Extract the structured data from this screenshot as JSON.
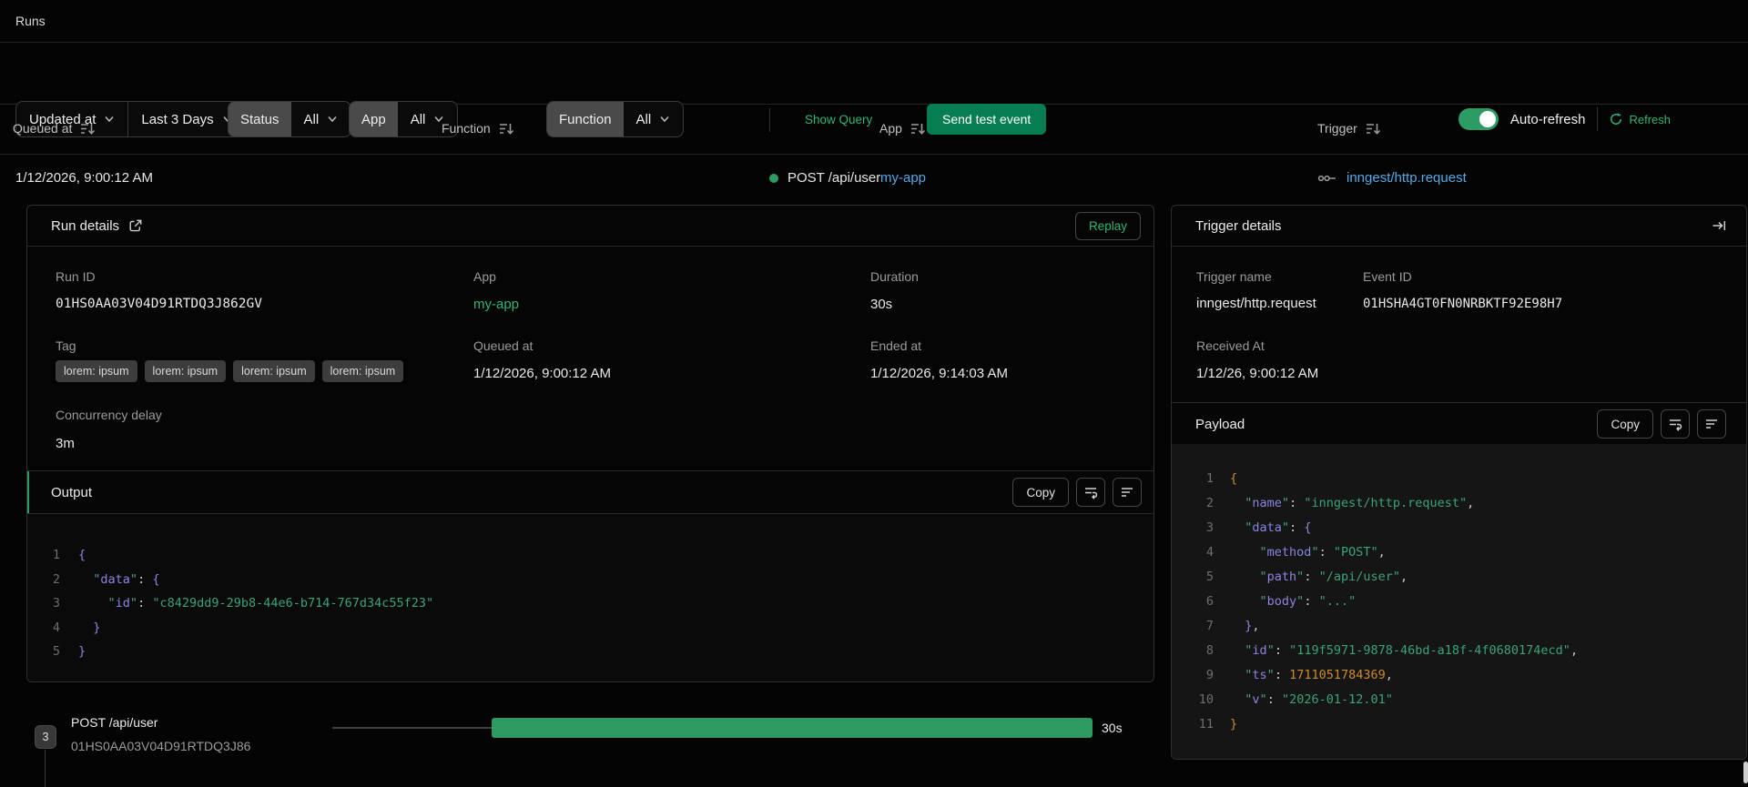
{
  "topbar": {
    "title": "Runs"
  },
  "filters": {
    "sort_field": "Updated at",
    "time_range": "Last 3 Days",
    "status_label": "Status",
    "status_value": "All",
    "app_label": "App",
    "app_value": "All",
    "function_label": "Function",
    "function_value": "All",
    "show_query": "Show Query",
    "send_test_event": "Send test event",
    "auto_refresh_label": "Auto-refresh",
    "auto_refresh_on": true,
    "refresh_label": "Refresh"
  },
  "table": {
    "columns": [
      "Queued at",
      "Function",
      "App",
      "Trigger"
    ],
    "row": {
      "queued_at": "1/12/2026, 9:00:12 AM",
      "function": "POST /api/user",
      "app": "my-app",
      "trigger": "inngest/http.request"
    }
  },
  "run_details": {
    "title": "Run details",
    "replay_label": "Replay",
    "run_id_label": "Run ID",
    "run_id": "01HS0AA03V04D91RTDQ3J862GV",
    "app_label": "App",
    "app": "my-app",
    "duration_label": "Duration",
    "duration": "30s",
    "tag_label": "Tag",
    "tags": [
      "lorem: ipsum",
      "lorem: ipsum",
      "lorem: ipsum",
      "lorem: ipsum"
    ],
    "queued_at_label": "Queued at",
    "queued_at": "1/12/2026, 9:00:12 AM",
    "ended_at_label": "Ended at",
    "ended_at": "1/12/2026, 9:14:03 AM",
    "concurrency_label": "Concurrency delay",
    "concurrency": "3m",
    "output": {
      "title": "Output",
      "copy_label": "Copy",
      "lines": [
        {
          "n": 1,
          "t": [
            [
              "br1",
              "{"
            ]
          ]
        },
        {
          "n": 2,
          "t": [
            [
              "pun",
              "  "
            ],
            [
              "qk",
              "\""
            ],
            [
              "key",
              "data"
            ],
            [
              "qk",
              "\""
            ],
            [
              "pun",
              ": "
            ],
            [
              "br1",
              "{"
            ]
          ]
        },
        {
          "n": 3,
          "t": [
            [
              "pun",
              "    "
            ],
            [
              "qk",
              "\""
            ],
            [
              "key",
              "id"
            ],
            [
              "qk",
              "\""
            ],
            [
              "pun",
              ": "
            ],
            [
              "str",
              "\"c8429dd9-29b8-44e6-b714-767d34c55f23\""
            ]
          ]
        },
        {
          "n": 4,
          "t": [
            [
              "pun",
              "  "
            ],
            [
              "br1",
              "}"
            ]
          ]
        },
        {
          "n": 5,
          "t": [
            [
              "br1",
              "}"
            ]
          ]
        }
      ]
    }
  },
  "trigger_details": {
    "title": "Trigger details",
    "trigger_name_label": "Trigger name",
    "trigger_name": "inngest/http.request",
    "event_id_label": "Event ID",
    "event_id": "01HSHA4GT0FN0NRBKTF92E98H7",
    "received_at_label": "Received At",
    "received_at": "1/12/26, 9:00:12 AM",
    "payload": {
      "title": "Payload",
      "copy_label": "Copy",
      "lines": [
        {
          "n": 1,
          "t": [
            [
              "br0",
              "{"
            ]
          ]
        },
        {
          "n": 2,
          "t": [
            [
              "pun",
              "  "
            ],
            [
              "qk",
              "\""
            ],
            [
              "key",
              "name"
            ],
            [
              "qk",
              "\""
            ],
            [
              "pun",
              ": "
            ],
            [
              "str",
              "\"inngest/http.request\""
            ],
            [
              "pun",
              ","
            ]
          ]
        },
        {
          "n": 3,
          "t": [
            [
              "pun",
              "  "
            ],
            [
              "qk",
              "\""
            ],
            [
              "key",
              "data"
            ],
            [
              "qk",
              "\""
            ],
            [
              "pun",
              ": "
            ],
            [
              "br1",
              "{"
            ]
          ]
        },
        {
          "n": 4,
          "t": [
            [
              "pun",
              "    "
            ],
            [
              "qk",
              "\""
            ],
            [
              "key",
              "method"
            ],
            [
              "qk",
              "\""
            ],
            [
              "pun",
              ": "
            ],
            [
              "str",
              "\"POST\""
            ],
            [
              "pun",
              ","
            ]
          ]
        },
        {
          "n": 5,
          "t": [
            [
              "pun",
              "    "
            ],
            [
              "qk",
              "\""
            ],
            [
              "key",
              "path"
            ],
            [
              "qk",
              "\""
            ],
            [
              "pun",
              ": "
            ],
            [
              "str",
              "\"/api/user\""
            ],
            [
              "pun",
              ","
            ]
          ]
        },
        {
          "n": 6,
          "t": [
            [
              "pun",
              "    "
            ],
            [
              "qk",
              "\""
            ],
            [
              "key",
              "body"
            ],
            [
              "qk",
              "\""
            ],
            [
              "pun",
              ": "
            ],
            [
              "str",
              "\"...\""
            ]
          ]
        },
        {
          "n": 7,
          "t": [
            [
              "pun",
              "  "
            ],
            [
              "br1",
              "}"
            ],
            [
              "pun",
              ","
            ]
          ]
        },
        {
          "n": 8,
          "t": [
            [
              "pun",
              "  "
            ],
            [
              "qk",
              "\""
            ],
            [
              "key",
              "id"
            ],
            [
              "qk",
              "\""
            ],
            [
              "pun",
              ": "
            ],
            [
              "str",
              "\"119f5971-9878-46bd-a18f-4f0680174ecd\""
            ],
            [
              "pun",
              ","
            ]
          ]
        },
        {
          "n": 9,
          "t": [
            [
              "pun",
              "  "
            ],
            [
              "qk",
              "\""
            ],
            [
              "key",
              "ts"
            ],
            [
              "qk",
              "\""
            ],
            [
              "pun",
              ": "
            ],
            [
              "num",
              "1711051784369"
            ],
            [
              "pun",
              ","
            ]
          ]
        },
        {
          "n": 10,
          "t": [
            [
              "pun",
              "  "
            ],
            [
              "qk",
              "\""
            ],
            [
              "key",
              "v"
            ],
            [
              "qk",
              "\""
            ],
            [
              "pun",
              ": "
            ],
            [
              "str",
              "\"2026-01-12.01\""
            ]
          ]
        },
        {
          "n": 11,
          "t": [
            [
              "br0",
              "}"
            ]
          ]
        }
      ]
    }
  },
  "timeline": {
    "step_count": "3",
    "function": "POST /api/user",
    "run_id": "01HS0AA03V04D91RTDQ3J86",
    "duration": "30s"
  },
  "colors": {
    "background": "#040404",
    "accent_green": "#2d9c64",
    "green_text": "#2fb573",
    "button_green": "#077d52",
    "link_blue": "#55a9e4",
    "code_string": "#3aa377",
    "code_key": "#8a85e0",
    "code_number": "#cc8b2f",
    "tag_bg": "#3d3d3d"
  }
}
